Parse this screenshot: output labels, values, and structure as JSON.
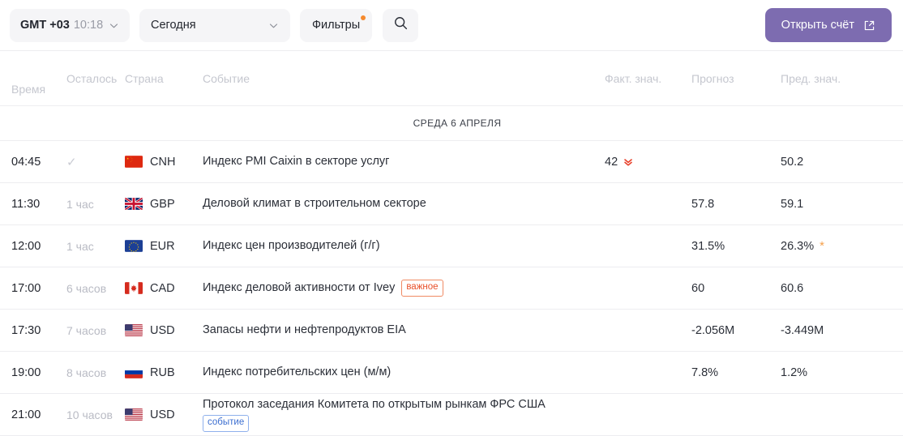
{
  "toolbar": {
    "timezone_label": "GMT +03",
    "time_value": "10:18",
    "period_label": "Сегодня",
    "filters_label": "Фильтры",
    "search_icon": "search-icon",
    "open_account_label": "Открыть счёт",
    "open_account_icon": "external-link-icon",
    "accent_color": "#7d6cb0",
    "filters_dot_color": "#f5892c"
  },
  "table": {
    "headers": {
      "time": "Время",
      "left": "Осталось",
      "country": "Страна",
      "event": "Событие",
      "actual": "Факт. знач.",
      "forecast": "Прогноз",
      "previous": "Пред. знач."
    },
    "date_separator": "СРЕДА 6 АПРЕЛЯ",
    "rows": [
      {
        "time": "04:45",
        "left": "",
        "status_icon": "check-icon",
        "flag": "cn",
        "currency": "CNH",
        "event": "Индекс PMI Caixin в секторе услуг",
        "badge": "",
        "badge_type": "",
        "actual": "42",
        "actual_trend": "down",
        "forecast": "",
        "previous": "50.2",
        "previous_revised": false
      },
      {
        "time": "11:30",
        "left": "1 час",
        "status_icon": "",
        "flag": "gb",
        "currency": "GBP",
        "event": "Деловой климат в строительном секторе",
        "badge": "",
        "badge_type": "",
        "actual": "",
        "actual_trend": "",
        "forecast": "57.8",
        "previous": "59.1",
        "previous_revised": false
      },
      {
        "time": "12:00",
        "left": "1 час",
        "status_icon": "",
        "flag": "eu",
        "currency": "EUR",
        "event": "Индекс цен производителей (г/г)",
        "badge": "",
        "badge_type": "",
        "actual": "",
        "actual_trend": "",
        "forecast": "31.5%",
        "previous": "26.3%",
        "previous_revised": true
      },
      {
        "time": "17:00",
        "left": "6 часов",
        "status_icon": "",
        "flag": "ca",
        "currency": "CAD",
        "event": "Индекс деловой активности от Ivey",
        "badge": "важное",
        "badge_type": "important",
        "actual": "",
        "actual_trend": "",
        "forecast": "60",
        "previous": "60.6",
        "previous_revised": false
      },
      {
        "time": "17:30",
        "left": "7 часов",
        "status_icon": "",
        "flag": "us",
        "currency": "USD",
        "event": "Запасы нефти и нефтепродуктов EIA",
        "badge": "",
        "badge_type": "",
        "actual": "",
        "actual_trend": "",
        "forecast": "-2.056M",
        "previous": "-3.449M",
        "previous_revised": false
      },
      {
        "time": "19:00",
        "left": "8 часов",
        "status_icon": "",
        "flag": "ru",
        "currency": "RUB",
        "event": "Индекс потребительских цен (м/м)",
        "badge": "",
        "badge_type": "",
        "actual": "",
        "actual_trend": "",
        "forecast": "7.8%",
        "previous": "1.2%",
        "previous_revised": false
      },
      {
        "time": "21:00",
        "left": "10 часов",
        "status_icon": "",
        "flag": "us",
        "currency": "USD",
        "event": "Протокол заседания Комитета по открытым рынкам ФРС США",
        "badge": "событие",
        "badge_type": "event",
        "actual": "",
        "actual_trend": "",
        "forecast": "",
        "previous": "",
        "previous_revised": false
      }
    ]
  }
}
